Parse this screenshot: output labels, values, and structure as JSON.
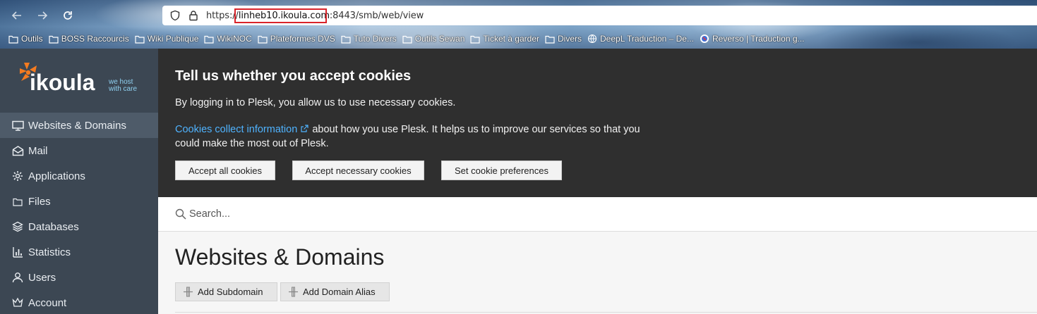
{
  "browser": {
    "url_scheme": "https://",
    "url_host": "linheb10.ikoula.com",
    "url_rest": ":8443/smb/web/view",
    "bookmarks": [
      {
        "label": "Outils",
        "icon": "folder-icon"
      },
      {
        "label": "BOSS Raccourcis",
        "icon": "folder-icon"
      },
      {
        "label": "Wiki Publique",
        "icon": "folder-icon"
      },
      {
        "label": "WikiNOC",
        "icon": "folder-icon"
      },
      {
        "label": "Plateformes DVS",
        "icon": "folder-icon"
      },
      {
        "label": "Tuto Divers",
        "icon": "folder-icon"
      },
      {
        "label": "Outils Sewan",
        "icon": "folder-icon"
      },
      {
        "label": "Ticket à garder",
        "icon": "folder-icon"
      },
      {
        "label": "Divers",
        "icon": "folder-icon"
      },
      {
        "label": "DeepL Traduction – De...",
        "icon": "globe-icon"
      },
      {
        "label": "Reverso | Traduction g...",
        "icon": "reverso-icon"
      }
    ]
  },
  "brand": {
    "name": "ikoula",
    "tagline_1": "we host",
    "tagline_2": "with care",
    "accent": "#f47b20"
  },
  "sidebar": {
    "items": [
      {
        "label": "Websites & Domains",
        "icon": "monitor-icon",
        "active": true
      },
      {
        "label": "Mail",
        "icon": "envelope-icon"
      },
      {
        "label": "Applications",
        "icon": "gear-icon"
      },
      {
        "label": "Files",
        "icon": "folder-icon"
      },
      {
        "label": "Databases",
        "icon": "layers-icon"
      },
      {
        "label": "Statistics",
        "icon": "bar-chart-icon"
      },
      {
        "label": "Users",
        "icon": "user-icon"
      },
      {
        "label": "Account",
        "icon": "crown-icon"
      }
    ]
  },
  "cookie_banner": {
    "title": "Tell us whether you accept cookies",
    "text_1": "By logging in to Plesk, you allow us to use necessary cookies.",
    "link_text": "Cookies collect information",
    "text_2": " about how you use Plesk. It helps us to improve our services so that you could make the most out of Plesk.",
    "buttons": {
      "accept_all": "Accept all cookies",
      "accept_necessary": "Accept necessary cookies",
      "preferences": "Set cookie preferences"
    }
  },
  "search": {
    "placeholder": "Search..."
  },
  "main": {
    "title": "Websites & Domains",
    "buttons": {
      "add_subdomain": "Add Subdomain",
      "add_domain_alias": "Add Domain Alias"
    }
  }
}
